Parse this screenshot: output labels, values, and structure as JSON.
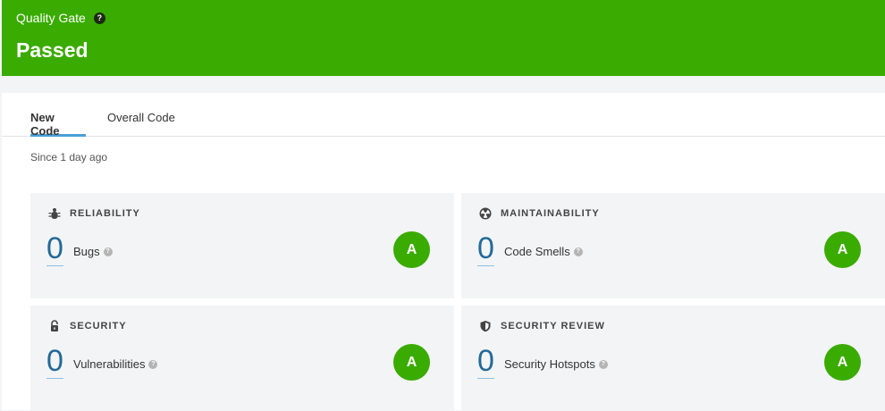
{
  "quality_gate": {
    "label": "Quality Gate",
    "help_symbol": "?",
    "status": "Passed",
    "status_color": "#3aab00"
  },
  "tabs": [
    {
      "label": "New Code",
      "active": true
    },
    {
      "label": "Overall Code",
      "active": false
    }
  ],
  "since": "Since 1 day ago",
  "accent": "#4b9fd5",
  "cards": [
    {
      "title": "RELIABILITY",
      "icon": "bug-icon",
      "value": "0",
      "label": "Bugs",
      "grade": "A"
    },
    {
      "title": "MAINTAINABILITY",
      "icon": "radiation-icon",
      "value": "0",
      "label": "Code Smells",
      "grade": "A"
    },
    {
      "title": "SECURITY",
      "icon": "lock-icon",
      "value": "0",
      "label": "Vulnerabilities",
      "grade": "A"
    },
    {
      "title": "SECURITY REVIEW",
      "icon": "shield-icon",
      "value": "0",
      "label": "Security Hotspots",
      "grade": "A"
    }
  ],
  "grade_color": "#3aab00",
  "help_small": "?"
}
